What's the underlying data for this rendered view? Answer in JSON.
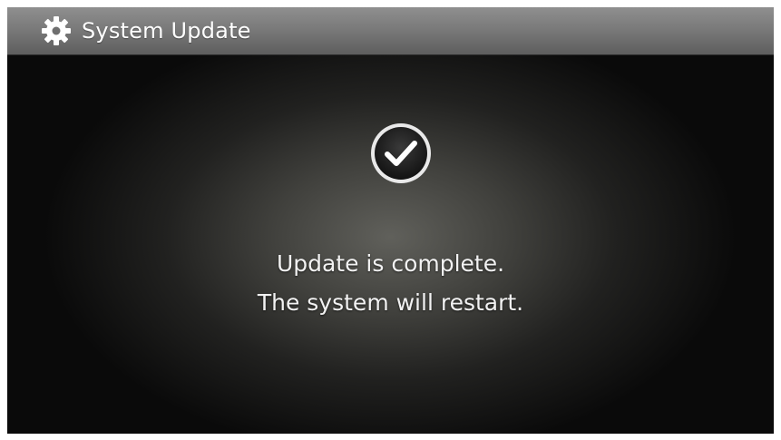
{
  "header": {
    "title": "System Update",
    "icon": "gear-icon"
  },
  "dialog": {
    "status_icon": "check-circle-icon",
    "message_line_1": "Update is complete.",
    "message_line_2": "The system will restart."
  },
  "colors": {
    "header_bg": "#7a7a7a",
    "screen_bg": "#0b0b0b",
    "text": "#ffffff"
  }
}
